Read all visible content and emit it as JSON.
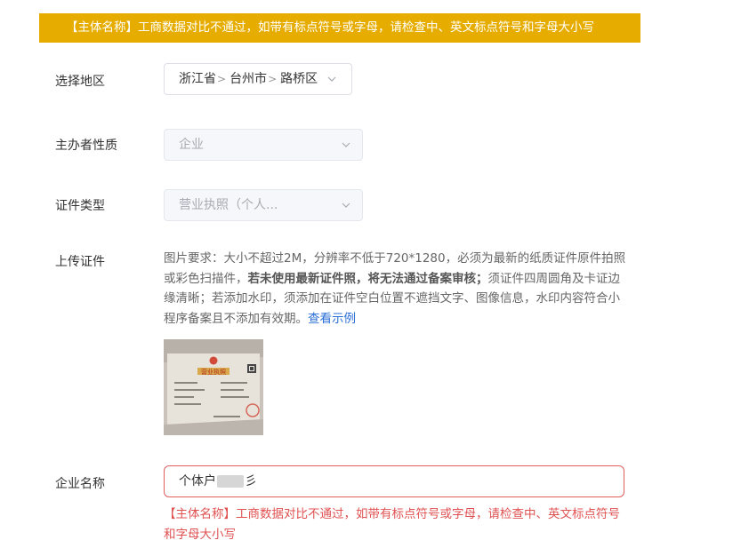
{
  "banner": {
    "text": "【主体名称】工商数据对比不通过，如带有标点符号或字母，请检查中、英文标点符号和字母大小写"
  },
  "region": {
    "label": "选择地区",
    "province": "浙江省",
    "city": "台州市",
    "district": "路桥区"
  },
  "sponsor_type": {
    "label": "主办者性质",
    "value": "企业"
  },
  "cert_type": {
    "label": "证件类型",
    "value": "营业执照（个人..."
  },
  "upload": {
    "label": "上传证件",
    "desc_part1": "图片要求：大小不超过2M，分辨率不低于720*1280，必须为最新的纸质证件原件拍照或彩色扫描件，",
    "desc_bold": "若未使用最新证件照，将无法通过备案审核；",
    "desc_part2": "须证件四周圆角及卡证边缘清晰；若添加水印，须添加在证件空白位置不遮挡文字、图像信息，水印内容符合小程序备案且不添加有效期。",
    "example_link": "查看示例",
    "thumb_title": "营业执照"
  },
  "company_name": {
    "label": "企业名称",
    "value_prefix": "个体户",
    "value_suffix": "彡",
    "error": "【主体名称】工商数据对比不通过，如带有标点符号或字母，请检查中、英文标点符号和字母大小写"
  }
}
